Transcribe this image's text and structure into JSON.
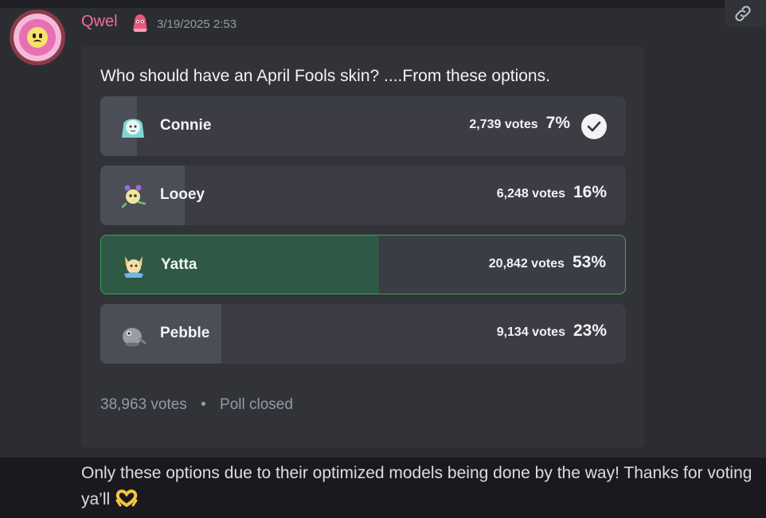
{
  "message": {
    "author": "Qwel",
    "timestamp": "3/19/2025 2:53",
    "body_text": "Only these options due to their optimized models being done by the way! Thanks for voting ya’ll",
    "body_emoji": "heart-hands-emoji"
  },
  "poll": {
    "question": "Who should have an April Fools skin? ....From these options.",
    "options": [
      {
        "name": "Connie",
        "votes": "2,739 votes",
        "percent": "7%",
        "fraction": 0.07,
        "avatar_icon": "connie-avatar-icon",
        "checked": true
      },
      {
        "name": "Looey",
        "votes": "6,248 votes",
        "percent": "16%",
        "fraction": 0.16,
        "avatar_icon": "looey-avatar-icon",
        "checked": false
      },
      {
        "name": "Yatta",
        "votes": "20,842 votes",
        "percent": "53%",
        "fraction": 0.53,
        "avatar_icon": "yatta-avatar-icon",
        "checked": false,
        "winner": true
      },
      {
        "name": "Pebble",
        "votes": "9,134 votes",
        "percent": "23%",
        "fraction": 0.23,
        "avatar_icon": "pebble-avatar-icon",
        "checked": false
      }
    ],
    "total_votes": "38,963 votes",
    "separator": "•",
    "status": "Poll closed"
  },
  "colors": {
    "author": "#f06b9c",
    "winner_border": "#3ba55c",
    "winner_fill": "#2e5a45"
  }
}
